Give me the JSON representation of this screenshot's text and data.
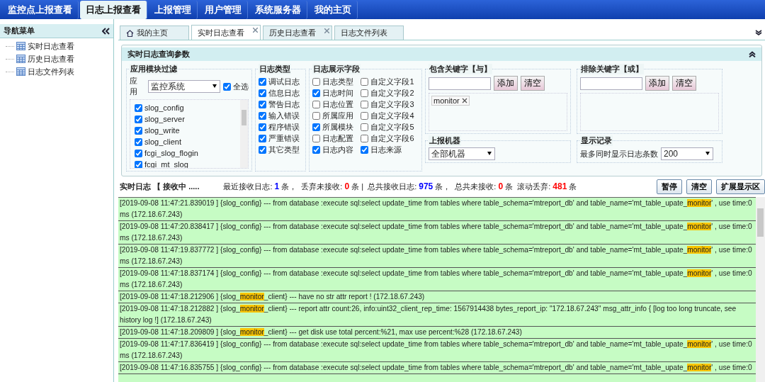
{
  "top_nav": [
    {
      "label": "监控点上报查看",
      "selected": false
    },
    {
      "label": "日志上报查看",
      "selected": true
    },
    {
      "label": "上报管理",
      "selected": false
    },
    {
      "label": "用户管理",
      "selected": false
    },
    {
      "label": "系统服务器",
      "selected": false
    },
    {
      "label": "我的主页",
      "selected": false
    }
  ],
  "sidebar": {
    "title": "导航菜单",
    "items": [
      {
        "label": "实时日志查看"
      },
      {
        "label": "历史日志查看"
      },
      {
        "label": "日志文件列表"
      }
    ]
  },
  "tabs": [
    {
      "label": "我的主页",
      "selected": false,
      "kind": "home",
      "closable": false
    },
    {
      "label": "实时日志查看",
      "selected": true,
      "kind": "plain",
      "closable": true
    },
    {
      "label": "历史日志查看",
      "selected": false,
      "kind": "plain",
      "closable": true
    },
    {
      "label": "日志文件列表",
      "selected": false,
      "kind": "plain",
      "closable": false
    }
  ],
  "query_panel": {
    "title": "实时日志查询参数",
    "module_filter": {
      "legend": "应用模块过滤",
      "app_label": "应用",
      "app_value": "监控系统",
      "select_all": {
        "label": "全选",
        "checked": true
      },
      "modules": [
        {
          "label": "slog_config",
          "checked": true
        },
        {
          "label": "slog_server",
          "checked": true
        },
        {
          "label": "slog_write",
          "checked": true
        },
        {
          "label": "slog_client",
          "checked": true
        },
        {
          "label": "fcgi_slog_flogin",
          "checked": true
        },
        {
          "label": "fcgi_mt_slog",
          "checked": true
        }
      ]
    },
    "log_types": {
      "legend": "日志类型",
      "items": [
        {
          "label": "调试日志",
          "checked": true
        },
        {
          "label": "信息日志",
          "checked": true
        },
        {
          "label": "警告日志",
          "checked": true
        },
        {
          "label": "输入错误",
          "checked": true
        },
        {
          "label": "程序错误",
          "checked": true
        },
        {
          "label": "严重错误",
          "checked": true
        },
        {
          "label": "其它类型",
          "checked": true
        }
      ]
    },
    "display_fields": {
      "legend": "日志展示字段",
      "items": [
        {
          "label": "日志类型",
          "checked": false
        },
        {
          "label": "自定义字段1",
          "checked": false
        },
        {
          "label": "日志时间",
          "checked": true
        },
        {
          "label": "自定义字段2",
          "checked": false
        },
        {
          "label": "日志位置",
          "checked": false
        },
        {
          "label": "自定义字段3",
          "checked": false
        },
        {
          "label": "所属应用",
          "checked": false
        },
        {
          "label": "自定义字段4",
          "checked": false
        },
        {
          "label": "所属模块",
          "checked": true
        },
        {
          "label": "自定义字段5",
          "checked": false
        },
        {
          "label": "日志配置",
          "checked": false
        },
        {
          "label": "自定义字段6",
          "checked": false
        },
        {
          "label": "日志内容",
          "checked": true
        },
        {
          "label": "日志来源",
          "checked": true
        }
      ]
    },
    "include_keywords": {
      "legend": "包含关键字【与】",
      "add_button": "添加",
      "clear_button": "清空",
      "tags": [
        "monitor"
      ]
    },
    "exclude_keywords": {
      "legend": "排除关键字【或】",
      "add_button": "添加",
      "clear_button": "清空"
    },
    "machines": {
      "legend": "上报机器",
      "value": "全部机器"
    },
    "display_records": {
      "legend": "显示记录",
      "label": "最多同时显示日志条数",
      "value": "200"
    }
  },
  "log_header": {
    "title": "实时日志 【 接收中 .....",
    "stats": [
      {
        "label": "最近接收日志:",
        "value": "1",
        "unit": "条，",
        "color": "#0000ff"
      },
      {
        "label": "丢弃未接收:",
        "value": "0",
        "unit": "条 |",
        "color": "#ff0000"
      },
      {
        "label": "总共接收日志:",
        "value": "975",
        "unit": "条，",
        "color": "#0000ff"
      },
      {
        "label": "总共未接收:",
        "value": "0",
        "unit": "条",
        "color": "#ff0000"
      },
      {
        "label": "滚动丢弃:",
        "value": "481",
        "unit": "条",
        "color": "#ff0000"
      }
    ],
    "buttons": [
      "暂停",
      "清空",
      "扩展显示区"
    ]
  },
  "log_entries": [
    {
      "parts": [
        {
          "text": "[2019-09-08 11:47:21.839019 ] {slog_config} --- from database :execute sql:select update_time from tables where table_schema='mtreport_db' and table_name='mt_table_upate_",
          "highlighted": false
        },
        {
          "text": "monitor",
          "highlighted": true
        },
        {
          "text": "' , use time:0 ms (172.18.67.243)",
          "highlighted": false
        }
      ]
    },
    {
      "parts": [
        {
          "text": "[2019-09-08 11:47:20.838417 ] {slog_config} --- from database :execute sql:select update_time from tables where table_schema='mtreport_db' and table_name='mt_table_upate_",
          "highlighted": false
        },
        {
          "text": "monitor",
          "highlighted": true
        },
        {
          "text": "' , use time:0 ms (172.18.67.243)",
          "highlighted": false
        }
      ]
    },
    {
      "parts": [
        {
          "text": "[2019-09-08 11:47:19.837772 ] {slog_config} --- from database :execute sql:select update_time from tables where table_schema='mtreport_db' and table_name='mt_table_upate_",
          "highlighted": false
        },
        {
          "text": "monitor",
          "highlighted": true
        },
        {
          "text": "' , use time:0 ms (172.18.67.243)",
          "highlighted": false
        }
      ]
    },
    {
      "parts": [
        {
          "text": "[2019-09-08 11:47:18.837174 ] {slog_config} --- from database :execute sql:select update_time from tables where table_schema='mtreport_db' and table_name='mt_table_upate_",
          "highlighted": false
        },
        {
          "text": "monitor",
          "highlighted": true
        },
        {
          "text": "' , use time:0 ms (172.18.67.243)",
          "highlighted": false
        }
      ]
    },
    {
      "parts": [
        {
          "text": "[2019-09-08 11:47:18.212906 ] {slog_",
          "highlighted": false
        },
        {
          "text": "monitor",
          "highlighted": true
        },
        {
          "text": "_client} --- have no str attr report ! (172.18.67.243)",
          "highlighted": false
        }
      ]
    },
    {
      "parts": [
        {
          "text": "[2019-09-08 11:47:18.212882 ] {slog_",
          "highlighted": false
        },
        {
          "text": "monitor",
          "highlighted": true
        },
        {
          "text": "_client} --- report attr count:26, info:uint32_client_rep_time: 1567914438 bytes_report_ip: \"172.18.67.243\" msg_attr_info { [log too long truncate, see history log !] (172.18.67.243)",
          "highlighted": false
        }
      ]
    },
    {
      "parts": [
        {
          "text": "[2019-09-08 11:47:18.209809 ] {slog_",
          "highlighted": false
        },
        {
          "text": "monitor",
          "highlighted": true
        },
        {
          "text": "_client} --- get disk use total percent:%21, max use percent:%28 (172.18.67.243)",
          "highlighted": false
        }
      ]
    },
    {
      "parts": [
        {
          "text": "[2019-09-08 11:47:17.836419 ] {slog_config} --- from database :execute sql:select update_time from tables where table_schema='mtreport_db' and table_name='mt_table_upate_",
          "highlighted": false
        },
        {
          "text": "monitor",
          "highlighted": true
        },
        {
          "text": "' , use time:0 ms (172.18.67.243)",
          "highlighted": false
        }
      ]
    },
    {
      "parts": [
        {
          "text": "[2019-09-08 11:47:16.835755 ] {slog_config} --- from database :execute sql:select update_time from tables where table_schema='mtreport_db' and table_name='mt_table_upate_",
          "highlighted": false
        },
        {
          "text": "monitor",
          "highlighted": true
        },
        {
          "text": "' , use time:0",
          "highlighted": false
        }
      ]
    }
  ]
}
